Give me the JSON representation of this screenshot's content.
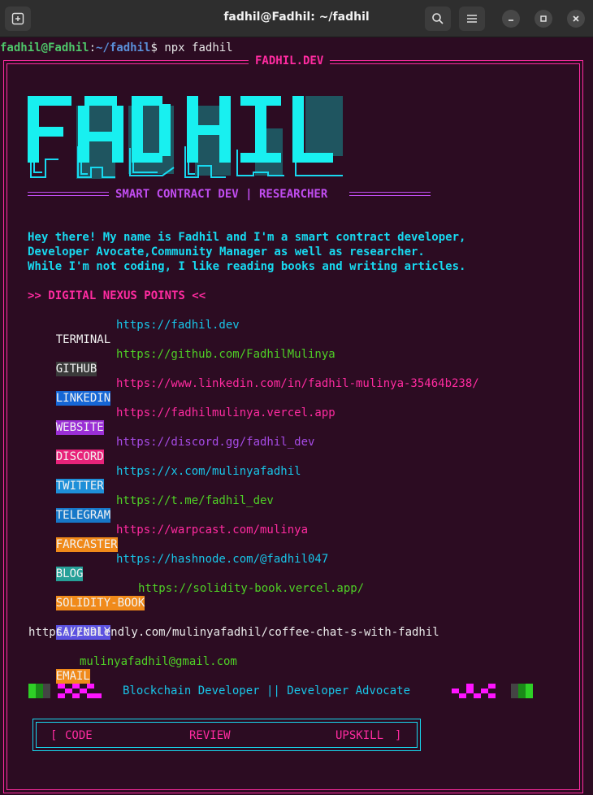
{
  "window": {
    "title": "fadhil@Fadhil: ~/fadhil"
  },
  "titlebar_icons": [
    "new-tab-icon",
    "search-icon",
    "hamburger-menu-icon",
    "minimize-icon",
    "maximize-icon",
    "close-icon"
  ],
  "prompt": {
    "user_host": "fadhil@Fadhil",
    "colon": ":",
    "path": "~/fadhil",
    "symbol": "$",
    "command": " npx fadhil"
  },
  "frame_title": "FADHIL.DEV",
  "logo_text": "FADHIL",
  "subtitle": "SMART CONTRACT DEV | RESEARCHER",
  "intro": {
    "line1": "Hey there! My name is Fadhil and I'm a smart contract developer,",
    "line2": "Developer Avocate,Community Manager as well as researcher.",
    "line3": "While I'm not coding, I like reading books and writing articles."
  },
  "nexus_heading": ">> DIGITAL NEXUS POINTS <<",
  "links": [
    {
      "label": "TERMINAL",
      "url": "https://fadhil.dev",
      "label_bg": "#2c0c22",
      "url_color": "#18c5e8"
    },
    {
      "label": "GITHUB",
      "url": "https://github.com/FadhilMulinya",
      "label_bg": "#3a3a3a",
      "url_color": "#4fd026"
    },
    {
      "label": "LINKEDIN",
      "url": "https://www.linkedin.com/in/fadhil-mulinya-35464b238/",
      "label_bg": "#1667d6",
      "url_color": "#ff2ba0"
    },
    {
      "label": "WEBSITE",
      "url": "https://fadhilmulinya.vercel.app",
      "label_bg": "#9b2fd6",
      "url_color": "#ff2ba0"
    },
    {
      "label": "DISCORD",
      "url": "https://discord.gg/fadhil_dev",
      "label_bg": "#e8237a",
      "url_color": "#a64be6"
    },
    {
      "label": "TWITTER",
      "url": "https://x.com/mulinyafadhil",
      "label_bg": "#1e8fd8",
      "url_color": "#18c5e8"
    },
    {
      "label": "TELEGRAM",
      "url": "https://t.me/fadhil_dev",
      "label_bg": "#1778c8",
      "url_color": "#4fd026"
    },
    {
      "label": "FARCASTER",
      "url": "https://warpcast.com/mulinya",
      "label_bg": "#f08a1a",
      "url_color": "#ff2ba0"
    },
    {
      "label": "BLOG",
      "url": "https://hashnode.com/@fadhil047",
      "label_bg": "#26a098",
      "url_color": "#18c5e8"
    },
    {
      "label": "SOLIDITY-BOOK",
      "url": "https://solidity-book.vercel.app/",
      "label_bg": "#f08a1a",
      "url_color": "#4fd026"
    },
    {
      "label": "CALENDLY",
      "url": "https://calendly.com/mulinyafadhil/coffee-chat-s-with-fadhil",
      "label_bg": "#5b52e0",
      "url_color": "#eaeaea"
    },
    {
      "label": "EMAIL",
      "url": "mulinyafadhil@gmail.com",
      "label_bg": "#f08a1a",
      "url_color": "#4fd026"
    }
  ],
  "footer_tagline": "Blockchain Developer || Developer Advocate",
  "buttons": {
    "left_bracket": "[",
    "code": "CODE",
    "review": "REVIEW",
    "upskill": "UPSKILL",
    "right_bracket": "]"
  },
  "colors": {
    "background": "#2c0c22",
    "cyan": "#18d9f0",
    "pink": "#ff2ba0",
    "purple": "#c04df0",
    "green": "#4fd026"
  }
}
